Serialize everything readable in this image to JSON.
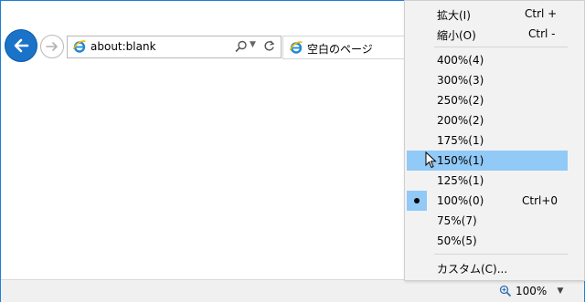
{
  "address_bar": {
    "url": "about:blank"
  },
  "tab": {
    "title": "空白のページ"
  },
  "zoom_menu": {
    "items": [
      {
        "label": "拡大(I)",
        "shortcut": "Ctrl +"
      },
      {
        "label": "縮小(O)",
        "shortcut": "Ctrl -"
      },
      {
        "label": "400%(4)",
        "shortcut": ""
      },
      {
        "label": "300%(3)",
        "shortcut": ""
      },
      {
        "label": "250%(2)",
        "shortcut": ""
      },
      {
        "label": "200%(2)",
        "shortcut": ""
      },
      {
        "label": "175%(1)",
        "shortcut": ""
      },
      {
        "label": "150%(1)",
        "shortcut": "",
        "highlighted": true
      },
      {
        "label": "125%(1)",
        "shortcut": ""
      },
      {
        "label": "100%(0)",
        "shortcut": "Ctrl+0",
        "checked": true
      },
      {
        "label": "75%(7)",
        "shortcut": ""
      },
      {
        "label": "50%(5)",
        "shortcut": ""
      },
      {
        "label": "カスタム(C)...",
        "shortcut": ""
      }
    ]
  },
  "status_bar": {
    "zoom_label": "100%"
  },
  "colors": {
    "accent": "#1a73c8",
    "menu_highlight": "#91c9f7",
    "menu_bg": "#f2f2f2"
  },
  "icons": [
    "back-arrow-icon",
    "forward-arrow-icon",
    "ie-logo-icon",
    "search-icon",
    "dropdown-arrow-icon",
    "refresh-icon",
    "smiley-icon",
    "zoom-magnifier-icon",
    "mouse-cursor-icon"
  ]
}
